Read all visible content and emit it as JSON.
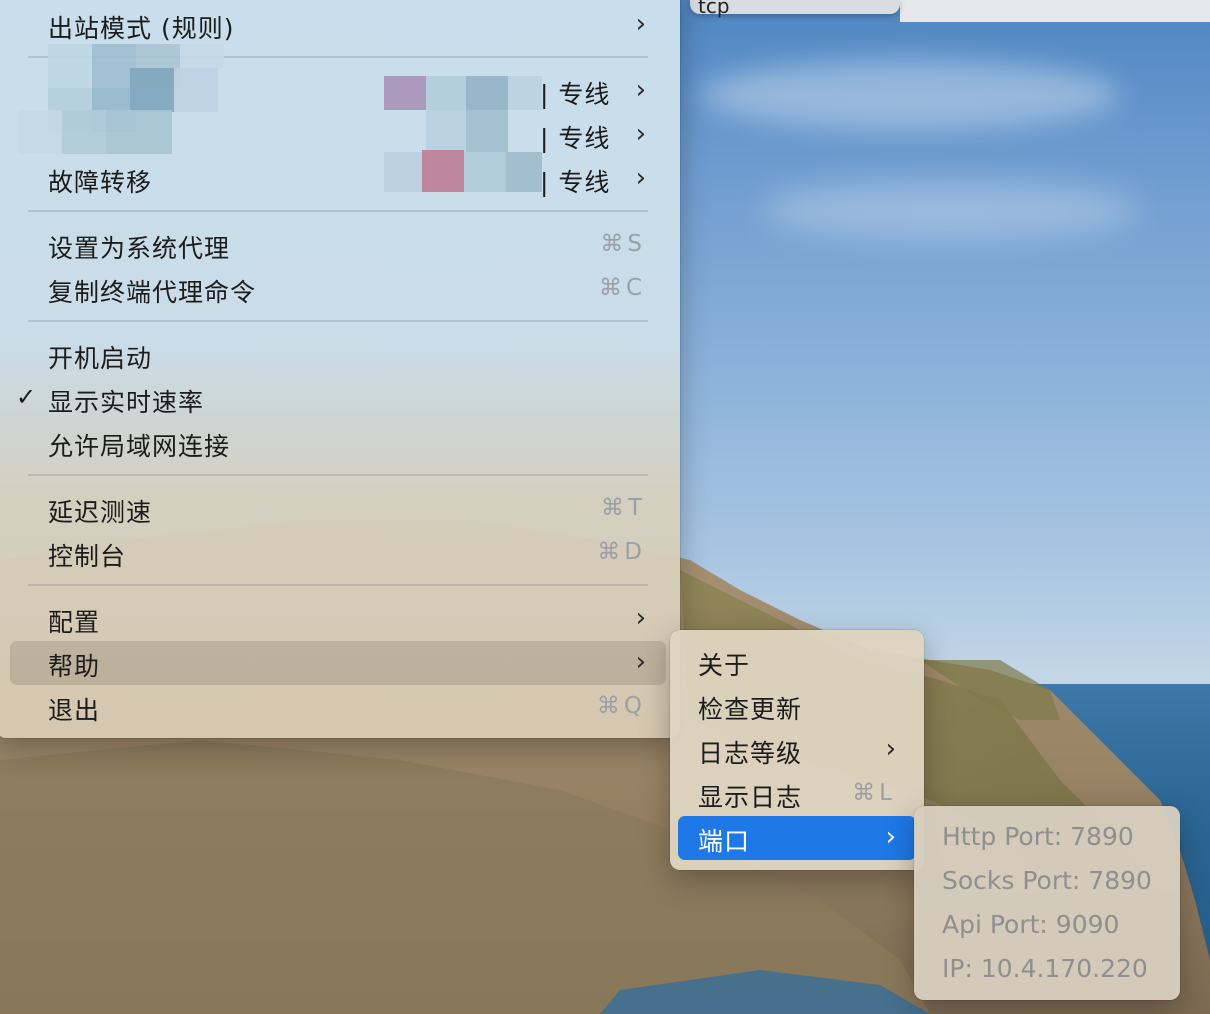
{
  "desktop": {
    "top_window_text": "tcp"
  },
  "main_menu": {
    "outbound_mode": "出站模式 (规则)",
    "proxies": [
      {
        "suffix": "| 专线"
      },
      {
        "suffix": "| 专线"
      },
      {
        "label": "故障转移",
        "suffix": "| 专线"
      }
    ],
    "set_system_proxy": {
      "label": "设置为系统代理",
      "shortcut": "⌘S"
    },
    "copy_shell_cmd": {
      "label": "复制终端代理命令",
      "shortcut": "⌘C"
    },
    "start_at_login": "开机启动",
    "show_speed": {
      "label": "显示实时速率",
      "checked": true
    },
    "allow_lan": "允许局域网连接",
    "latency_test": {
      "label": "延迟测速",
      "shortcut": "⌘T"
    },
    "dashboard": {
      "label": "控制台",
      "shortcut": "⌘D"
    },
    "config": "配置",
    "help": "帮助",
    "quit": {
      "label": "退出",
      "shortcut": "⌘Q"
    }
  },
  "help_menu": {
    "about": "关于",
    "check_update": "检查更新",
    "log_level": "日志等级",
    "show_log": {
      "label": "显示日志",
      "shortcut": "⌘L"
    },
    "ports": "端口"
  },
  "port_menu": {
    "http": "Http Port: 7890",
    "socks": "Socks Port: 7890",
    "api": "Api Port: 9090",
    "ip": "IP: 10.4.170.220"
  },
  "icons": {
    "submenu": "chevron-right-icon",
    "check": "checkmark-icon"
  },
  "colors": {
    "highlight": "#1e78e6",
    "shortcut": "#9aa0a6"
  }
}
